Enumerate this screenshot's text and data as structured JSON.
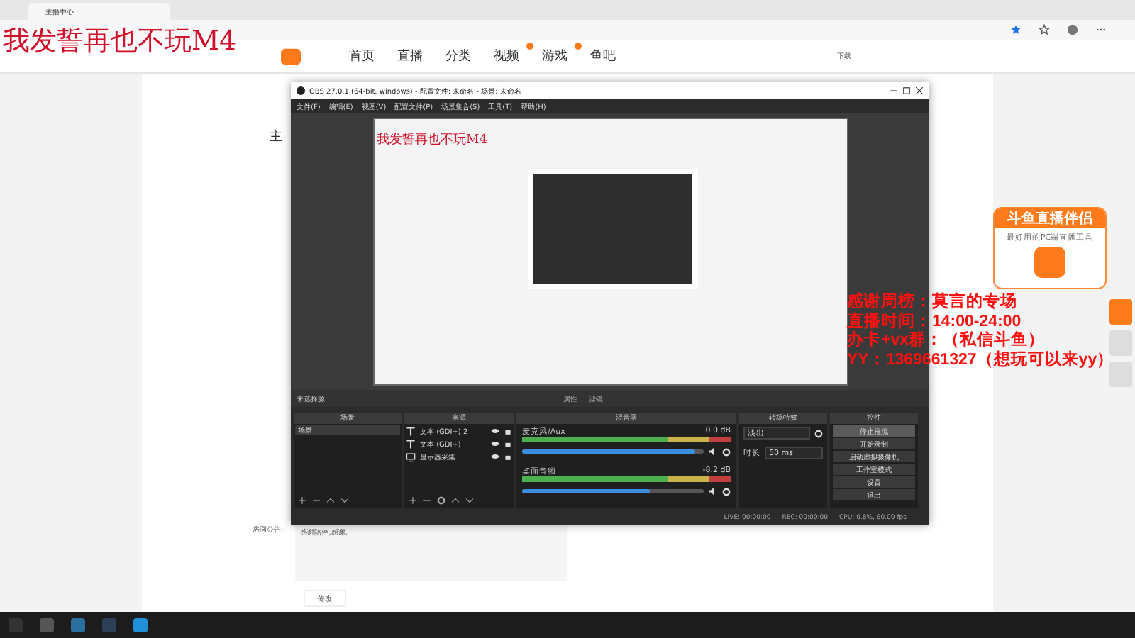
{
  "browser": {
    "tabs": [
      {
        "title": "主播中心",
        "selected": true
      }
    ]
  },
  "site": {
    "nav": [
      {
        "label": "首页",
        "badge": false
      },
      {
        "label": "直播",
        "badge": false
      },
      {
        "label": "分类",
        "badge": false
      },
      {
        "label": "视频",
        "badge": true
      },
      {
        "label": "游戏",
        "badge": true
      },
      {
        "label": "鱼吧",
        "badge": false
      }
    ],
    "download": "下载",
    "page_side_label": "主"
  },
  "room": {
    "notice_label": "房间公告:",
    "notice_value": "感谢陪伴,感谢.",
    "edit_button": "修改"
  },
  "stream_overlay": {
    "headline": "我发誓再也不玩M4",
    "lines": [
      "感谢周榜：莫言的专场",
      "直播时间：14:00-24:00",
      "办卡+vx群：（私信斗鱼）",
      "YY：1369661327（想玩可以来yy）"
    ]
  },
  "promo": {
    "title": "斗鱼直播伴侣",
    "subtitle": "最好用的PC端直播工具"
  },
  "obs": {
    "title": "OBS 27.0.1 (64-bit, windows) - 配置文件: 未命名 - 场景: 未命名",
    "menu": [
      "文件(F)",
      "编辑(E)",
      "视图(V)",
      "配置文件(P)",
      "场景集合(S)",
      "工具(T)",
      "帮助(H)"
    ],
    "preview": {
      "headline": "我发誓再也不玩M4"
    },
    "source_bar": {
      "label": "未选择源",
      "properties": "属性",
      "filters": "滤镜"
    },
    "scenes": {
      "header": "场景",
      "items": [
        {
          "name": "场景",
          "selected": true
        }
      ]
    },
    "sources": {
      "header": "来源",
      "items": [
        {
          "name": "文本 (GDI+) 2",
          "kind": "text"
        },
        {
          "name": "文本 (GDI+)",
          "kind": "text"
        },
        {
          "name": "显示器采集",
          "kind": "display"
        }
      ]
    },
    "mixer": {
      "header": "混音器",
      "channels": [
        {
          "name": "麦克风/Aux",
          "reading": "0.0 dB",
          "level": 0.95,
          "muted": false
        },
        {
          "name": "桌面音频",
          "reading": "-8.2 dB",
          "level": 0.7,
          "muted": false
        }
      ]
    },
    "transitions": {
      "header": "转场特效",
      "effect": "淡出",
      "duration_label": "时长",
      "duration": "50 ms"
    },
    "controls": {
      "header": "控件",
      "buttons": [
        {
          "label": "停止推流",
          "selected": true
        },
        {
          "label": "开始录制",
          "selected": false
        },
        {
          "label": "启动虚拟摄像机",
          "selected": false
        },
        {
          "label": "工作室模式",
          "selected": false
        },
        {
          "label": "设置",
          "selected": false
        },
        {
          "label": "退出",
          "selected": false
        }
      ]
    },
    "status": {
      "live": "LIVE: 00:00:00",
      "rec": "REC: 00:00:00",
      "cpu": "CPU: 0.8%, 60.00 fps"
    }
  }
}
